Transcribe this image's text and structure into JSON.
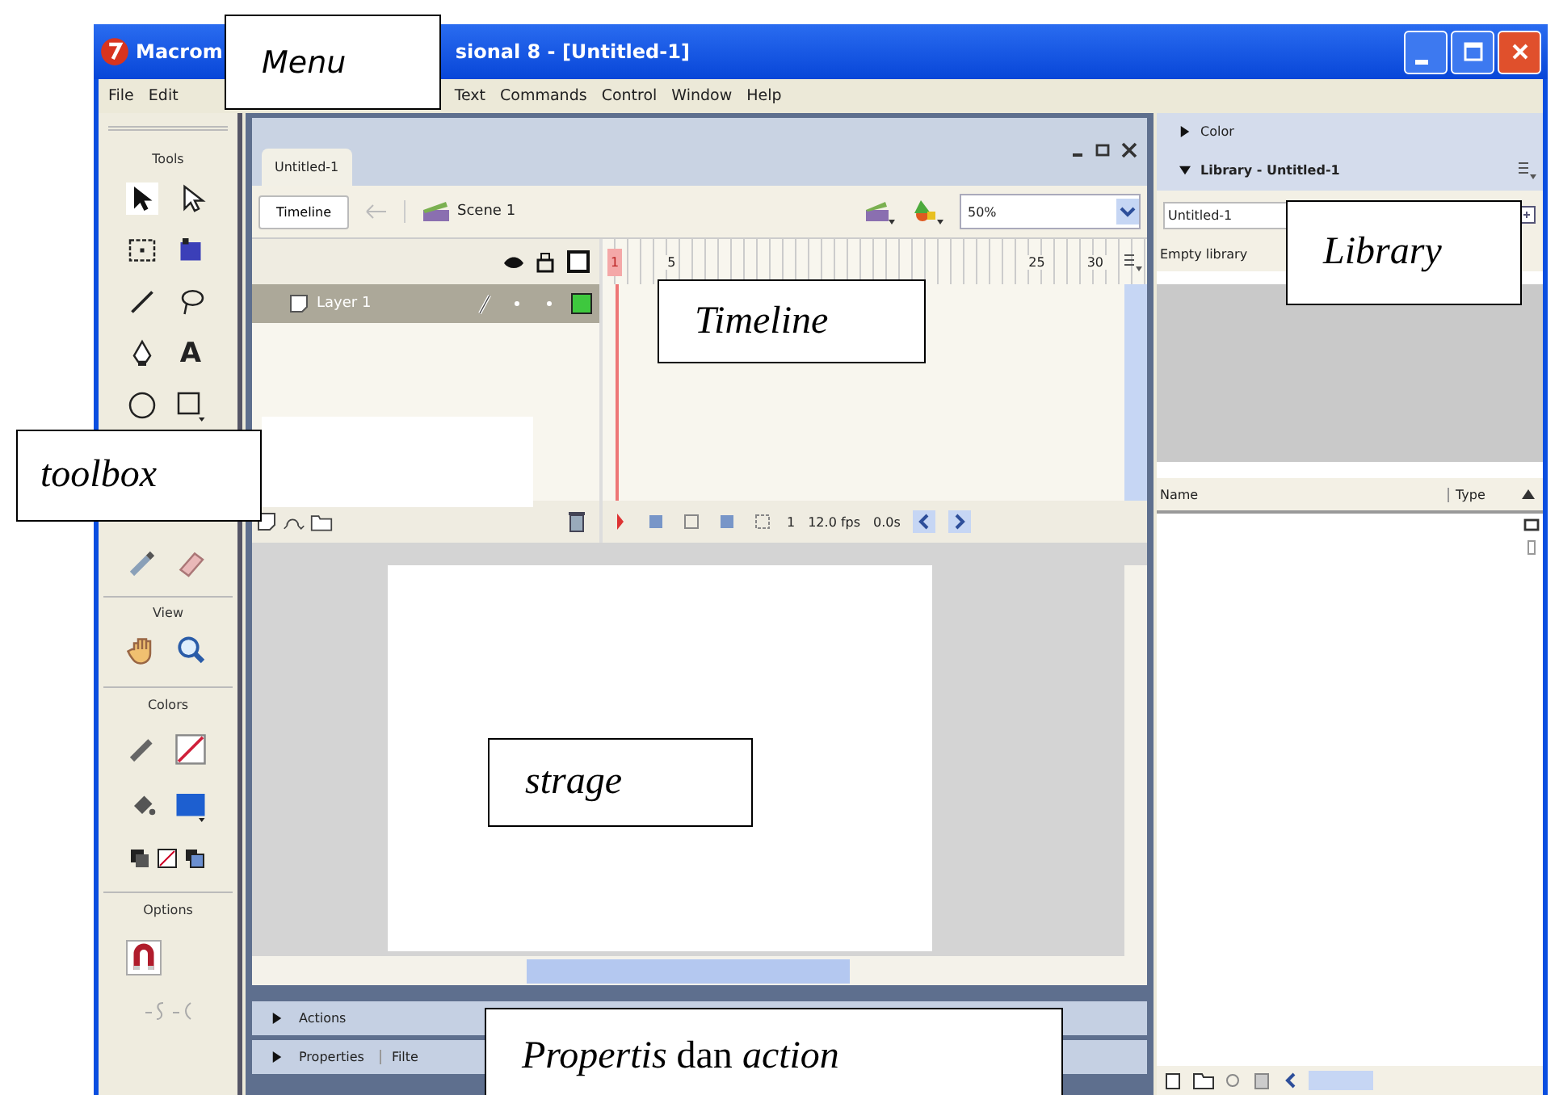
{
  "window": {
    "title_parts": [
      "Macrom",
      "sional 8 - [Untitled-1]"
    ]
  },
  "menu": [
    "File",
    "Edit",
    "Text",
    "Commands",
    "Control",
    "Window",
    "Help"
  ],
  "toolbox": {
    "title": "Tools",
    "text_glyph": "A",
    "sections": [
      "View",
      "Colors",
      "Options"
    ]
  },
  "document": {
    "tab": "Untitled-1",
    "timeline_button": "Timeline",
    "scene": "Scene 1",
    "zoom": "50%",
    "ruler": [
      "1",
      "5",
      "25",
      "30"
    ],
    "layers": [
      {
        "name": "Layer 1",
        "selected": true
      }
    ],
    "frame": "1",
    "fps": "12.0 fps",
    "time": "0.0s"
  },
  "bottom_panels": [
    {
      "title": "Actions",
      "expanded": false
    },
    {
      "title": "Properties",
      "expanded": false
    }
  ],
  "filters_tab": "Filte",
  "color_panel": {
    "title": "Color",
    "expanded": false
  },
  "library": {
    "title": "Library - Untitled-1",
    "expanded": true,
    "document": "Untitled-1",
    "status": "Empty library",
    "columns": [
      "Name",
      "Type"
    ]
  },
  "annotations": [
    {
      "kind": "menu",
      "text": "Menu"
    },
    {
      "kind": "timeline",
      "text": "Timeline"
    },
    {
      "kind": "library",
      "text": "Library"
    },
    {
      "kind": "toolbox",
      "text": "toolbox"
    },
    {
      "kind": "stage",
      "text": "strage"
    },
    {
      "kind": "panels",
      "text": "*Propertis* dan *action*"
    }
  ]
}
